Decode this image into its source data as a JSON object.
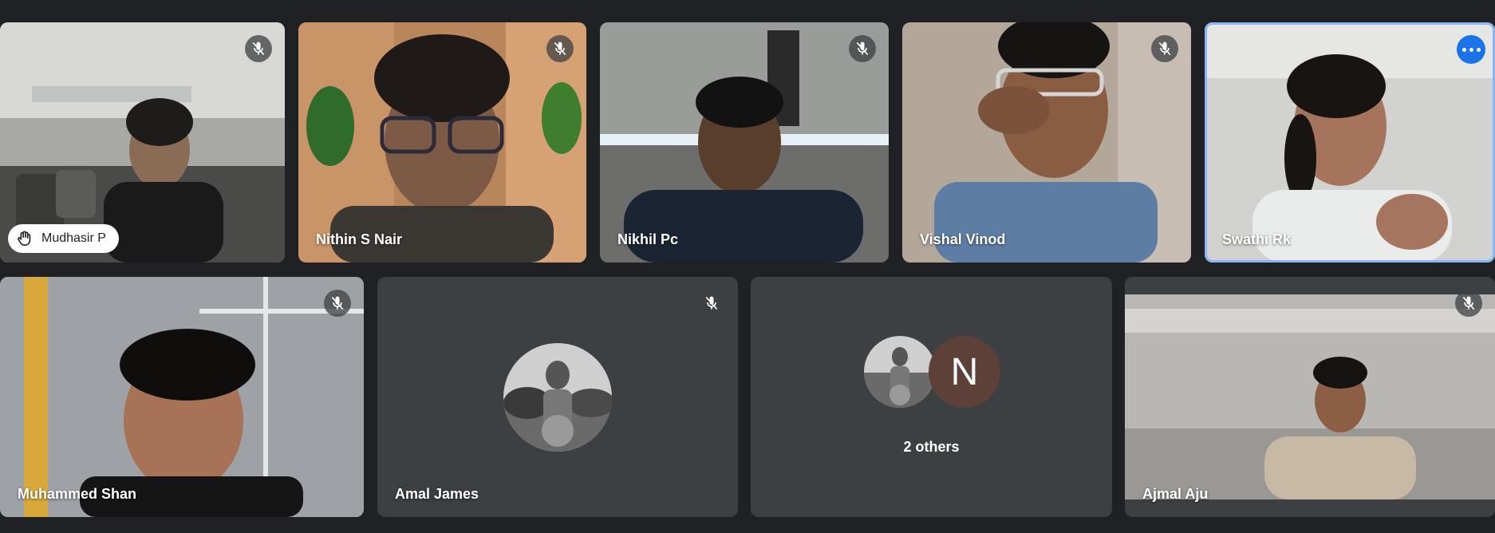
{
  "participants_row1": [
    {
      "name": "Mudhasir P",
      "muted": true,
      "hand_raised": true
    },
    {
      "name": "Nithin S Nair",
      "muted": true
    },
    {
      "name": "Nikhil Pc",
      "muted": true
    },
    {
      "name": "Vishal Vinod",
      "muted": true
    },
    {
      "name": "Swathi Rk",
      "muted": false,
      "active_speaker": true
    }
  ],
  "participants_row2": [
    {
      "name": "Muhammed Shan",
      "muted": true
    },
    {
      "name": "Amal James",
      "muted": true,
      "camera_off": true
    },
    {
      "others_label": "2 others",
      "letter_avatar": "N"
    },
    {
      "name": "Ajmal Aju",
      "muted": true
    }
  ],
  "colors": {
    "background": "#202124",
    "tile_off": "#3c4043",
    "active_border": "#8ab4f8",
    "more_button": "#1a73e8",
    "letter_avatar_bg": "#5d4037"
  },
  "icons": [
    "mic-off-icon",
    "hand-raised-icon",
    "more-options-icon"
  ]
}
